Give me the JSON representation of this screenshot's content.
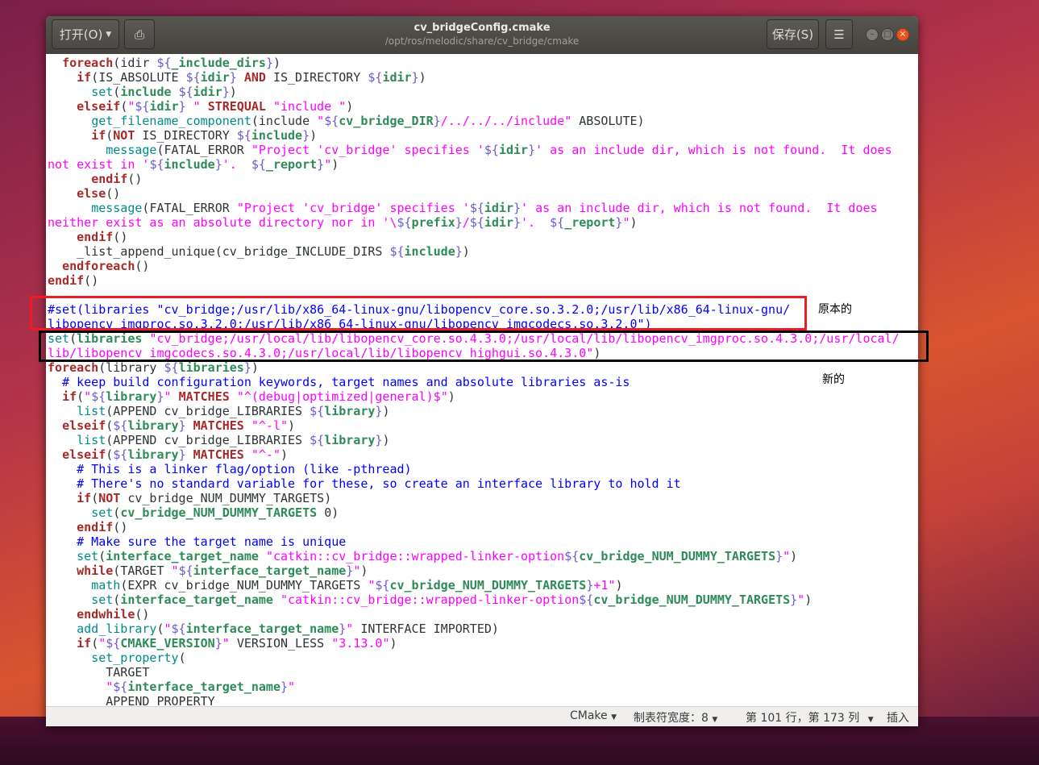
{
  "window": {
    "title": "cv_bridgeConfig.cmake",
    "path": "/opt/ros/melodic/share/cv_bridge/cmake",
    "open_label": "打开(O)",
    "save_label": "保存(S)"
  },
  "code_lines": [
    "  foreach(idir ${_include_dirs})",
    "    if(IS_ABSOLUTE ${idir} AND IS_DIRECTORY ${idir})",
    "      set(include ${idir})",
    "    elseif(\"${idir} \" STREQUAL \"include \")",
    "      get_filename_component(include \"${cv_bridge_DIR}/../../../include\" ABSOLUTE)",
    "      if(NOT IS_DIRECTORY ${include})",
    "        message(FATAL_ERROR \"Project 'cv_bridge' specifies '${idir}' as an include dir, which is not found.  It does",
    "not exist in '${include}'.  ${_report}\")",
    "      endif()",
    "    else()",
    "      message(FATAL_ERROR \"Project 'cv_bridge' specifies '${idir}' as an include dir, which is not found.  It does",
    "neither exist as an absolute directory nor in '\\${prefix}/${idir}'.  ${_report}\")",
    "    endif()",
    "    _list_append_unique(cv_bridge_INCLUDE_DIRS ${include})",
    "  endforeach()",
    "endif()",
    "",
    "#set(libraries \"cv_bridge;/usr/lib/x86_64-linux-gnu/libopencv_core.so.3.2.0;/usr/lib/x86_64-linux-gnu/",
    "libopencv_imgproc.so.3.2.0;/usr/lib/x86_64-linux-gnu/libopencv_imgcodecs.so.3.2.0\")",
    "set(libraries \"cv_bridge;/usr/local/lib/libopencv_core.so.4.3.0;/usr/local/lib/libopencv_imgproc.so.4.3.0;/usr/local/",
    "lib/libopencv_imgcodecs.so.4.3.0;/usr/local/lib/libopencv_highgui.so.4.3.0\")",
    "foreach(library ${libraries})",
    "  # keep build configuration keywords, target names and absolute libraries as-is",
    "  if(\"${library}\" MATCHES \"^(debug|optimized|general)$\")",
    "    list(APPEND cv_bridge_LIBRARIES ${library})",
    "  elseif(${library} MATCHES \"^-l\")",
    "    list(APPEND cv_bridge_LIBRARIES ${library})",
    "  elseif(${library} MATCHES \"^-\")",
    "    # This is a linker flag/option (like -pthread)",
    "    # There's no standard variable for these, so create an interface library to hold it",
    "    if(NOT cv_bridge_NUM_DUMMY_TARGETS)",
    "      set(cv_bridge_NUM_DUMMY_TARGETS 0)",
    "    endif()",
    "    # Make sure the target name is unique",
    "    set(interface_target_name \"catkin::cv_bridge::wrapped-linker-option${cv_bridge_NUM_DUMMY_TARGETS}\")",
    "    while(TARGET \"${interface_target_name}\")",
    "      math(EXPR cv_bridge_NUM_DUMMY_TARGETS \"${cv_bridge_NUM_DUMMY_TARGETS}+1\")",
    "      set(interface_target_name \"catkin::cv_bridge::wrapped-linker-option${cv_bridge_NUM_DUMMY_TARGETS}\")",
    "    endwhile()",
    "    add_library(\"${interface_target_name}\" INTERFACE IMPORTED)",
    "    if(\"${CMAKE_VERSION}\" VERSION_LESS \"3.13.0\")",
    "      set_property(",
    "        TARGET",
    "        \"${interface_target_name}\"",
    "        APPEND PROPERTY"
  ],
  "statusbar": {
    "language": "CMake",
    "tab_width": "制表符宽度：8",
    "position": "第 101 行，第 173 列",
    "mode": "插入"
  },
  "annotations": {
    "original_label": "原本的",
    "new_label": "新的",
    "original_box_color": "#ed1c24",
    "new_box_color": "#000000"
  },
  "syntax_colors": {
    "keyword": "#a52a2a",
    "function": "#008b8b",
    "string": "#ff00ff",
    "variable": "#2e8b57",
    "comment": "#0000ff"
  }
}
